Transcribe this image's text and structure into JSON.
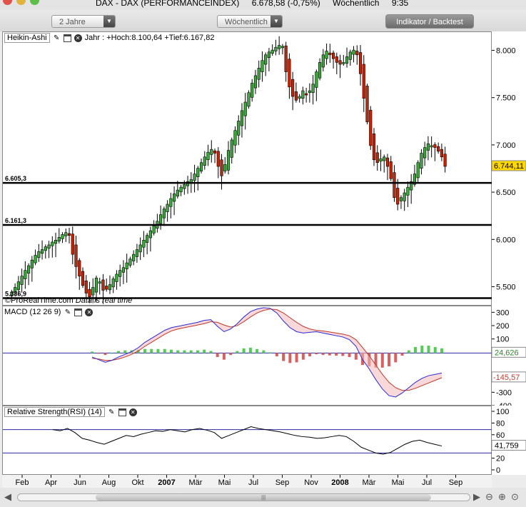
{
  "window": {
    "title_symbol": "DAX - DAX (PERFORMANCEINDEX)",
    "title_price": "6.678,58 (-0,75%)",
    "title_period": "Wöchentlich",
    "title_time": "9:35"
  },
  "toolbar": {
    "range_select": "2 Jahre",
    "period_select": "Wöchentlich",
    "indicator_button": "Indikator / Backtest"
  },
  "price_panel": {
    "name": "Heikin-Ashi",
    "info": "Jahr : +Hoch:8.100,64 +Tief:6.167,82",
    "last_value": "6.744,11",
    "hline_labels": [
      "6.605,3",
      "6.161,3",
      "5.386,9"
    ],
    "footer_source": "©ProRealTime.com",
    "footer_note": "Data is real time"
  },
  "macd_panel": {
    "name": "MACD (12 26 9)",
    "value_hist": "24,626",
    "value_signal": "-145,57"
  },
  "rsi_panel": {
    "name": "Relative Strength(RSI) (14)",
    "value": "41,759"
  },
  "time_axis": {
    "labels": [
      "Feb",
      "Apr",
      "Jun",
      "Aug",
      "Okt",
      "2007",
      "Mär",
      "Mai",
      "Jul",
      "Sep",
      "Nov",
      "2008",
      "Mär",
      "Mai",
      "Jul",
      "Sep"
    ]
  },
  "colors": {
    "up": "#3aa83a",
    "down": "#cc2200",
    "macd_hist_up": "#55cc55",
    "macd_hist_down": "#d96060",
    "hline": "#000000",
    "blue_line": "#2a2aa0"
  },
  "chart_data": [
    {
      "type": "candlestick",
      "title": "Heikin-Ashi",
      "ylim": [
        5300,
        8200
      ],
      "y_ticks": [
        5500,
        6000,
        6500,
        7000,
        7500,
        8000
      ],
      "y_tick_labels": [
        "5.500",
        "6.000",
        "6.500",
        "7.000",
        "7.500",
        "8.000"
      ],
      "horizontal_lines": [
        6605.3,
        6161.3,
        5386.9
      ],
      "series": [
        {
          "name": "DAX",
          "close": [
            5450,
            5500,
            5560,
            5620,
            5680,
            5730,
            5790,
            5840,
            5880,
            5900,
            5930,
            5950,
            5980,
            6000,
            6030,
            6060,
            6080,
            6050,
            5850,
            5720,
            5620,
            5520,
            5440,
            5400,
            5500,
            5600,
            5560,
            5470,
            5480,
            5530,
            5590,
            5640,
            5680,
            5710,
            5760,
            5800,
            5850,
            5900,
            5950,
            6000,
            6050,
            6100,
            6150,
            6200,
            6270,
            6330,
            6380,
            6440,
            6490,
            6530,
            6560,
            6590,
            6620,
            6640,
            6700,
            6760,
            6820,
            6880,
            6930,
            6960,
            6920,
            6780,
            6680,
            6800,
            6950,
            7060,
            7160,
            7260,
            7370,
            7460,
            7560,
            7660,
            7740,
            7820,
            7900,
            7960,
            7990,
            8010,
            8040,
            8060,
            8050,
            7780,
            7620,
            7520,
            7480,
            7520,
            7580,
            7540,
            7580,
            7650,
            7780,
            7880,
            7960,
            8000,
            7960,
            7920,
            7880,
            7860,
            7880,
            7940,
            7990,
            8010,
            7960,
            7760,
            7500,
            7250,
            7000,
            6850,
            6820,
            6860,
            6880,
            6780,
            6650,
            6450,
            6380,
            6450,
            6500,
            6560,
            6620,
            6700,
            6820,
            6920,
            6980,
            7020,
            7000,
            6980,
            6940,
            6880,
            6780
          ]
        }
      ]
    },
    {
      "type": "line",
      "title": "MACD (12 26 9)",
      "ylim": [
        -400,
        350
      ],
      "y_ticks": [
        300,
        200,
        100,
        -300,
        -400
      ],
      "series": [
        {
          "name": "MACD",
          "values": [
            -30,
            -50,
            -70,
            -55,
            -30,
            -10,
            10,
            40,
            80,
            110,
            140,
            170,
            190,
            200,
            210,
            220,
            230,
            245,
            250,
            200,
            160,
            180,
            220,
            270,
            310,
            330,
            340,
            335,
            300,
            240,
            190,
            160,
            150,
            155,
            160,
            150,
            140,
            130,
            120,
            100,
            50,
            -50,
            -120,
            -200,
            -270,
            -320,
            -330,
            -300,
            -260,
            -220,
            -190,
            -170,
            -160,
            -150
          ]
        },
        {
          "name": "Signal",
          "values": [
            -40,
            -45,
            -55,
            -55,
            -45,
            -30,
            -10,
            15,
            50,
            80,
            110,
            140,
            165,
            180,
            190,
            200,
            210,
            220,
            235,
            230,
            210,
            195,
            205,
            235,
            270,
            300,
            320,
            330,
            325,
            300,
            265,
            230,
            200,
            180,
            170,
            165,
            158,
            150,
            142,
            130,
            100,
            40,
            -20,
            -90,
            -160,
            -220,
            -260,
            -280,
            -280,
            -265,
            -245,
            -225,
            -205,
            -185
          ]
        },
        {
          "name": "Histogram",
          "values": [
            10,
            -5,
            -15,
            0,
            15,
            20,
            20,
            25,
            30,
            30,
            30,
            30,
            25,
            20,
            20,
            20,
            20,
            25,
            15,
            -30,
            -50,
            -15,
            15,
            35,
            40,
            30,
            20,
            5,
            -25,
            -60,
            -75,
            -70,
            -50,
            -25,
            -10,
            -15,
            -18,
            -20,
            -22,
            -30,
            -50,
            -90,
            -100,
            -110,
            -110,
            -100,
            -70,
            -20,
            20,
            45,
            55,
            55,
            45,
            35
          ]
        }
      ]
    },
    {
      "type": "line",
      "title": "Relative Strength(RSI) (14)",
      "ylim": [
        0,
        100
      ],
      "y_ticks": [
        100,
        80,
        60,
        40,
        20,
        0
      ],
      "horizontal_lines": [
        70,
        30
      ],
      "series": [
        {
          "name": "RSI",
          "values": [
            70,
            68,
            72,
            65,
            55,
            52,
            48,
            45,
            50,
            55,
            60,
            58,
            62,
            65,
            68,
            67,
            70,
            68,
            66,
            70,
            72,
            69,
            65,
            55,
            60,
            65,
            70,
            75,
            72,
            70,
            68,
            66,
            63,
            60,
            58,
            57,
            55,
            56,
            58,
            60,
            58,
            50,
            40,
            35,
            30,
            28,
            31,
            38,
            45,
            50,
            52,
            48,
            45,
            42
          ]
        }
      ]
    }
  ]
}
